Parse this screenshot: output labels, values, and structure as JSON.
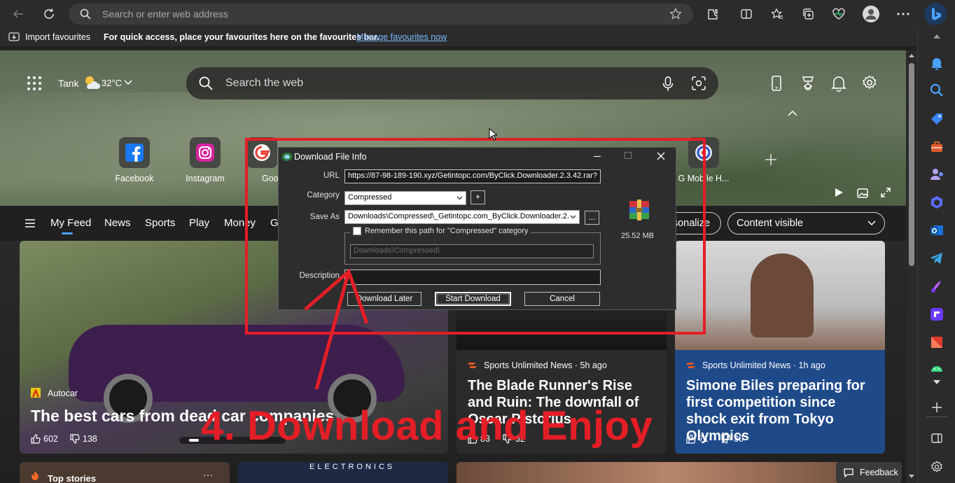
{
  "browser": {
    "address_placeholder": "Search or enter web address",
    "favbar": {
      "import": "Import favourites",
      "hint": "For quick access, place your favourites here on the favourites bar.",
      "manage_link": "Manage favourites now"
    }
  },
  "ntp": {
    "weather": {
      "location": "Tank",
      "temp": "32°C"
    },
    "search_placeholder": "Search the web",
    "quick_links": [
      {
        "label": "Facebook",
        "icon": "facebook-icon"
      },
      {
        "label": "Instagram",
        "icon": "instagram-icon"
      },
      {
        "label": "Goo",
        "icon": "google-icon"
      },
      {
        "label": "G Mobile H...",
        "icon": "pubg-icon"
      }
    ],
    "nav": {
      "items": [
        "My Feed",
        "News",
        "Sports",
        "Play",
        "Money",
        "G"
      ],
      "personalize": "rsonalize",
      "content_visible": "Content visible"
    },
    "cards": [
      {
        "source": "Autocar",
        "title": "The best cars from dead car companies",
        "likes": "602",
        "dislikes": "138"
      },
      {
        "source": "Sports Unlimited News",
        "age": "5h ago",
        "title": "The Blade Runner's Rise and Ruin: The downfall of Oscar Pistorius",
        "likes": "83",
        "dislikes": "32"
      },
      {
        "source": "Sports Unlimited News",
        "age": "1h ago",
        "title": "Simone Biles preparing for first competition since shock exit from Tokyo Olympics",
        "likes": "71",
        "dislikes": "30"
      }
    ],
    "bottom": {
      "top_stories": "Top stories",
      "electronics": "ELECTRONICS",
      "feedback": "Feedback"
    }
  },
  "dialog": {
    "title": "Download File Info",
    "url_label": "URL",
    "url_value": "https://87-98-189-190.xyz/Getintopc.com/ByClick.Downloader.2.3.42.rar?",
    "category_label": "Category",
    "category_value": "Compressed",
    "add_button": "+",
    "saveas_label": "Save As",
    "saveas_value": "Downloads\\Compressed\\_Getintopc.com_ByClick.Downloader.2.",
    "browse_button": "...",
    "remember_label": "Remember this path for \"Compressed\" category",
    "remember_path": "Downloads\\Compressed\\",
    "description_label": "Description",
    "description_value": "",
    "file_size": "25.52 MB",
    "buttons": {
      "later": "Download Later",
      "start": "Start Download",
      "cancel": "Cancel"
    }
  },
  "annotation": {
    "caption": "4. Download and Enjoy"
  },
  "colors": {
    "annotation_red": "#e41e26",
    "link_blue": "#7ab7ff",
    "accent": "#4aa3ff"
  }
}
